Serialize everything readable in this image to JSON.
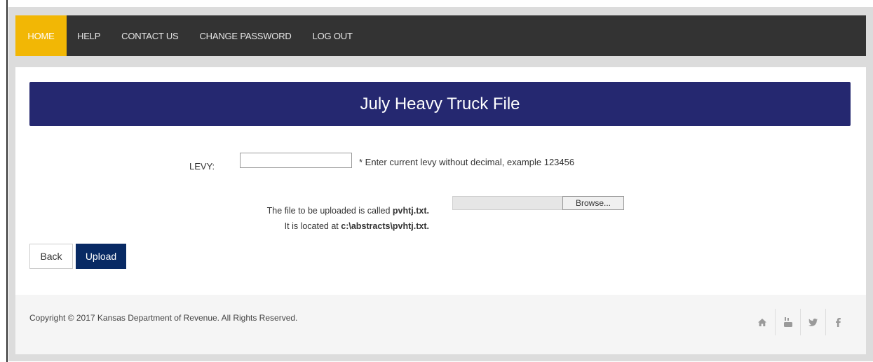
{
  "nav": {
    "items": [
      {
        "label": "HOME",
        "active": true
      },
      {
        "label": "HELP"
      },
      {
        "label": "CONTACT US"
      },
      {
        "label": "CHANGE PASSWORD"
      },
      {
        "label": "LOG OUT"
      }
    ]
  },
  "page": {
    "title": "July Heavy Truck File"
  },
  "levy": {
    "label": "LEVY:",
    "value": "",
    "hint": "* Enter current levy without decimal, example 123456"
  },
  "file": {
    "line1_prefix": "The file to be uploaded is called ",
    "line1_name": "pvhtj.txt.",
    "line2_prefix": "It is located at ",
    "line2_path": "c:\\abstracts\\pvhtj.txt.",
    "browse_label": "Browse..."
  },
  "actions": {
    "back_label": "Back",
    "upload_label": "Upload"
  },
  "footer": {
    "copyright": "Copyright © 2017 Kansas Department of Revenue. All Rights Reserved.",
    "social": [
      "home-icon",
      "youtube-icon",
      "twitter-icon",
      "facebook-icon"
    ]
  },
  "colors": {
    "nav_bg": "#333333",
    "nav_active": "#f2b705",
    "title_bar": "#252870",
    "upload_button": "#082a64"
  }
}
